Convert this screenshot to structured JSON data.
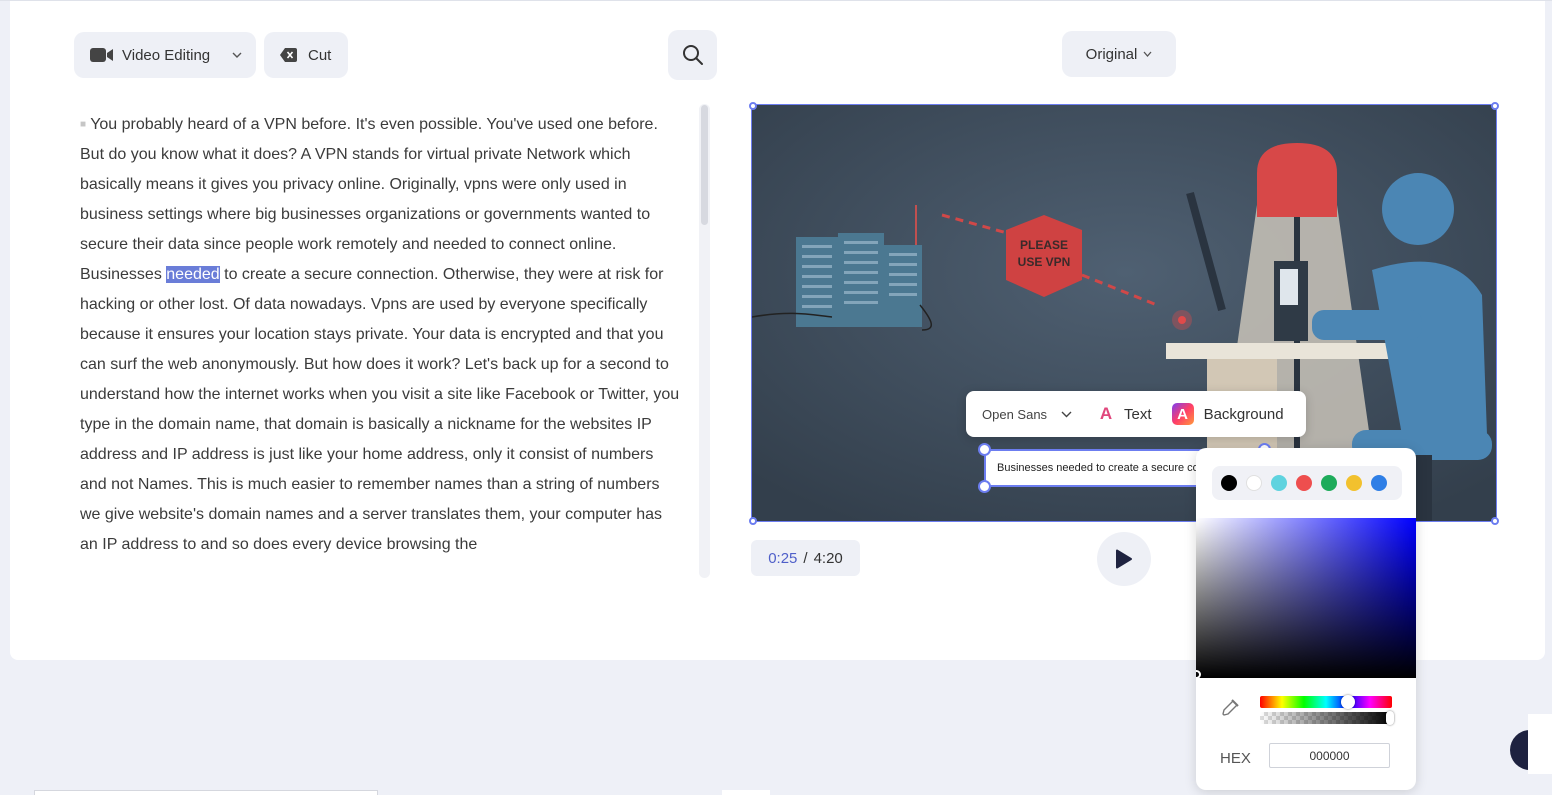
{
  "toolbar": {
    "mode_label": "Video Editing",
    "cut_label": "Cut",
    "view_label": "Original"
  },
  "transcript": {
    "before_highlight": "You probably heard of a VPN before. It's even possible. You've used one before. But do you know what it does? A VPN stands for virtual private Network which basically means it gives you privacy online. Originally, vpns were only used in business settings where big businesses organizations or governments wanted to secure their data since people work remotely and needed to connect online. Businesses",
    "highlight": "needed",
    "after_highlight": "to create a secure connection. Otherwise, they were at risk for hacking or other lost. Of data nowadays. Vpns are used by everyone specifically because it ensures your location stays private. Your data is encrypted and that you can surf the web anonymously. But how does it work? Let's back up for a second to understand how the internet works when you visit a site like Facebook or Twitter, you type in the domain name, that domain is basically a nickname for the websites IP address and IP address is just like your home address, only it consist of numbers and not Names. This is much easier to remember names than a string of numbers we give website's domain names and a server translates them, your computer has an IP address to and so does every device browsing the"
  },
  "video": {
    "sign_line1": "PLEASE",
    "sign_line2": "USE VPN",
    "caption": "Businesses needed to create a secure co"
  },
  "playback": {
    "current": "0:25",
    "separator": "/",
    "total": "4:20"
  },
  "text_toolbar": {
    "font": "Open Sans",
    "text_label": "Text",
    "text_icon_glyph": "A",
    "background_label": "Background",
    "background_icon_glyph": "A"
  },
  "color_picker": {
    "swatches": [
      "#000000",
      "#ffffff",
      "#5fd3df",
      "#ee4e4e",
      "#1eab5b",
      "#f2c12e",
      "#2f7fe6"
    ],
    "hex_label": "HEX",
    "hex_value": "000000",
    "hue_color": "#0000ff"
  },
  "colors": {
    "accent": "#6c7df0",
    "highlight": "#6a7dd8",
    "panel": "#eef0f6"
  }
}
